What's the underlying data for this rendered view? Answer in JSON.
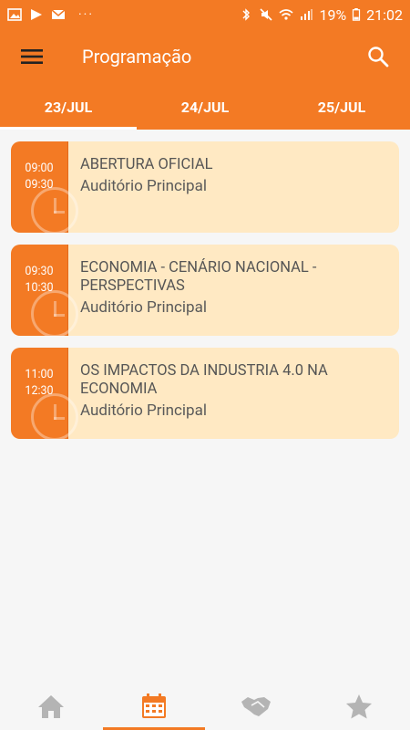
{
  "status_bar": {
    "battery_percent": "19%",
    "time": "21:02",
    "dots": "···",
    "left_icons": [
      "image-icon",
      "play-store-icon",
      "mail-icon"
    ],
    "right_icons": [
      "bluetooth-icon",
      "mute-icon",
      "wifi-icon",
      "signal-icon",
      "battery-icon"
    ]
  },
  "app_bar": {
    "title": "Programação",
    "menu_icon": "menu-icon",
    "search_icon": "search-icon"
  },
  "tabs": [
    {
      "label": "23/JUL",
      "active": true
    },
    {
      "label": "24/JUL",
      "active": false
    },
    {
      "label": "25/JUL",
      "active": false
    }
  ],
  "sessions": [
    {
      "start": "09:00",
      "end": "09:30",
      "title": "ABERTURA OFICIAL",
      "location": "Auditório Principal"
    },
    {
      "start": "09:30",
      "end": "10:30",
      "title": "ECONOMIA - CENÁRIO NACIONAL - PERSPECTIVAS",
      "location": "Auditório Principal"
    },
    {
      "start": "11:00",
      "end": "12:30",
      "title": "OS IMPACTOS DA INDUSTRIA 4.0 NA ECONOMIA",
      "location": "Auditório Principal"
    }
  ],
  "bottom_nav": [
    {
      "icon": "home-icon",
      "active": false
    },
    {
      "icon": "calendar-icon",
      "active": true
    },
    {
      "icon": "handshake-icon",
      "active": false
    },
    {
      "icon": "star-icon",
      "active": false
    }
  ],
  "colors": {
    "accent": "#f37a24",
    "card_bg": "#ffe9c3",
    "inactive_icon": "#b4b4b4"
  }
}
